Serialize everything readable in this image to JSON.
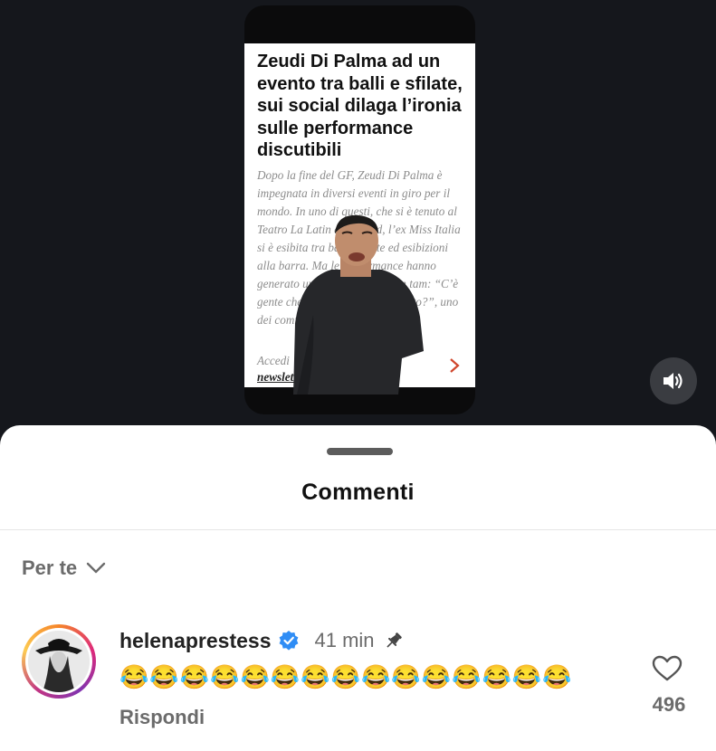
{
  "video": {
    "article": {
      "title": "Zeudi Di Palma ad un evento tra balli e sfilate, sui social dilaga l’ironia sulle performance discutibili",
      "body": "Dopo la fine del GF, Zeudi Di Palma è impegnata in diversi eventi in giro per il mondo. In uno di questi, che si è tenuto al Teatro La Latin di Madrid, l’ex Miss Italia si è esibita tra balli, sfilate ed esibizioni alla barra. Ma le performance hanno generato un vero e proprio tam tam: “C’è gente che è pagata per fare questo?”, uno dei commenti.",
      "cta": "Accedi",
      "link": "newsletter"
    },
    "sound_icon": "speaker-icon"
  },
  "sheet": {
    "title": "Commenti",
    "sort_label": "Per te",
    "sort_icon": "chevron-down-icon"
  },
  "comment": {
    "username": "helenaprestess",
    "time": "41 min",
    "text": "😂😂😂😂😂😂😂😂😂😂😂😂😂😂😂",
    "reply_label": "Rispondi",
    "likes": "496",
    "verified_icon": "verified-badge-icon",
    "pin_icon": "pin-icon",
    "like_icon": "heart-icon",
    "verified_color": "#2f8df5"
  }
}
